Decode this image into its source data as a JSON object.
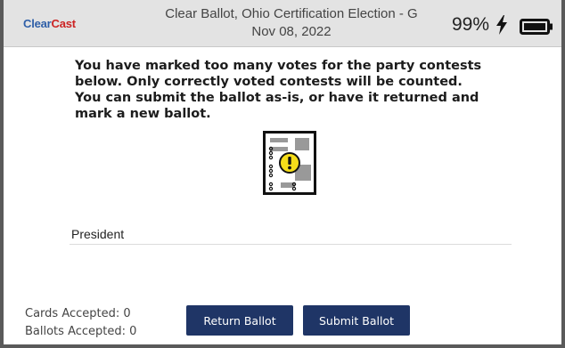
{
  "header": {
    "brand_clear": "Clear",
    "brand_cast": "Cast",
    "title_line1": "Clear Ballot, Ohio Certification Election - G",
    "title_line2": "Nov 08, 2022",
    "battery_percent": "99%",
    "charging_icon": "lightning-bolt-icon",
    "battery_icon": "battery-full-icon"
  },
  "message": {
    "line1": "You have marked too many votes for the party contests below. Only correctly voted contests will be counted.",
    "line2": "You can submit the ballot as-is, or have it returned and mark a new ballot."
  },
  "ballot_icon": "ballot-warning-icon",
  "contests": [
    {
      "label": "President"
    }
  ],
  "stats": {
    "cards_accepted": "Cards Accepted: 0",
    "ballots_accepted": "Ballots Accepted: 0"
  },
  "actions": {
    "return_label": "Return Ballot",
    "submit_label": "Submit Ballot"
  },
  "colors": {
    "brand_blue": "#2f5fa8",
    "brand_red": "#cc2424",
    "button_navy": "#1f3566",
    "warning_yellow": "#f5dd1a"
  }
}
